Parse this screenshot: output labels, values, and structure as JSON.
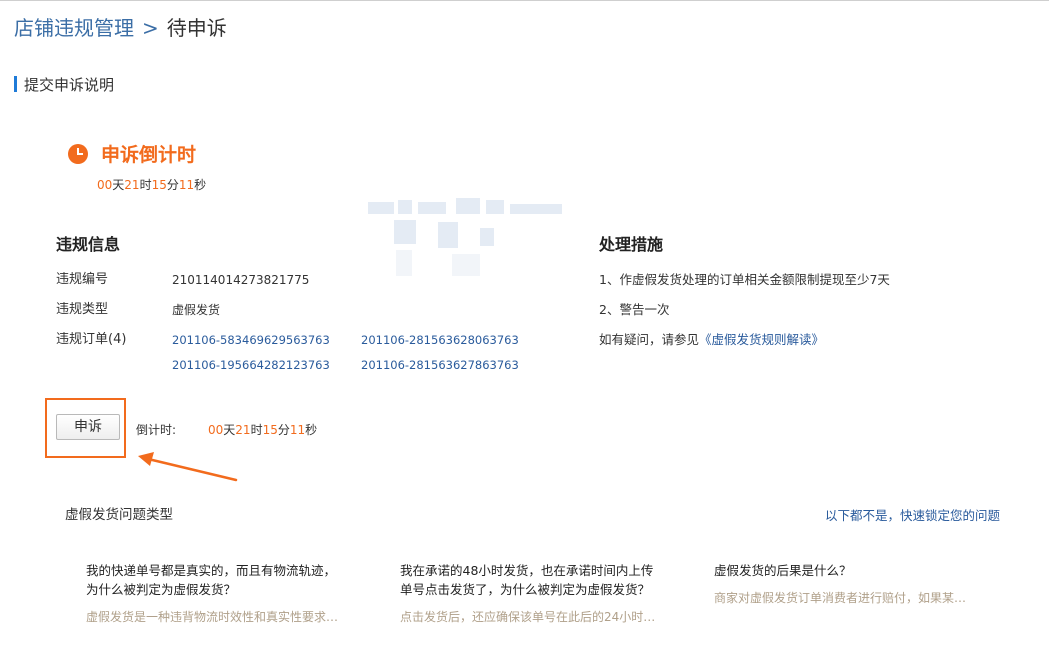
{
  "breadcrumb": {
    "parent": "店铺违规管理",
    "separator": ">",
    "current": "待申诉"
  },
  "section": {
    "title": "提交申诉说明"
  },
  "countdown": {
    "title": "申诉倒计时",
    "days": "00",
    "days_unit": "天",
    "hours": "21",
    "hours_unit": "时",
    "minutes": "15",
    "minutes_unit": "分",
    "seconds": "11",
    "seconds_unit": "秒"
  },
  "violation": {
    "heading": "违规信息",
    "id_label": "违规编号",
    "id_value": "210114014273821775",
    "type_label": "违规类型",
    "type_value": "虚假发货",
    "orders_label": "违规订单(4)",
    "orders": [
      "201106-583469629563763",
      "201106-281563628063763",
      "201106-195664282123763",
      "201106-281563627863763"
    ]
  },
  "measures": {
    "heading": "处理措施",
    "item1": "1、作虚假发货处理的订单相关金额限制提现至少7天",
    "item2": "2、警告一次",
    "question_prefix": "如有疑问，请参见",
    "question_link": "《虚假发货规则解读》"
  },
  "appeal": {
    "button_label": "申诉",
    "countdown_label": "倒计时:",
    "days": "00",
    "days_unit": "天",
    "hours": "21",
    "hours_unit": "时",
    "minutes": "15",
    "minutes_unit": "分",
    "seconds": "11",
    "seconds_unit": "秒"
  },
  "faq": {
    "title": "虚假发货问题类型",
    "quick_link": "以下都不是，快速锁定您的问题",
    "items": [
      {
        "question": "我的快递单号都是真实的，而且有物流轨迹，为什么被判定为虚假发货？",
        "answer": "虚假发货是一种违背物流时效性和真实性要求…"
      },
      {
        "question": "我在承诺的48小时发货，也在承诺时间内上传单号点击发货了，为什么被判定为虚假发货？",
        "answer": "点击发货后，还应确保该单号在此后的24小时…"
      },
      {
        "question": "虚假发货的后果是什么？",
        "answer": "商家对虚假发货订单消费者进行赔付，如果某…"
      }
    ]
  },
  "colors": {
    "accent": "#f26b1d",
    "link": "#2a5b9c",
    "breadcrumb_link": "#3b6ea6",
    "section_bar": "#1f7bd8",
    "faq_answer": "#b0a08a"
  },
  "icons": [
    "clock-icon",
    "arrow-annotation-icon"
  ]
}
